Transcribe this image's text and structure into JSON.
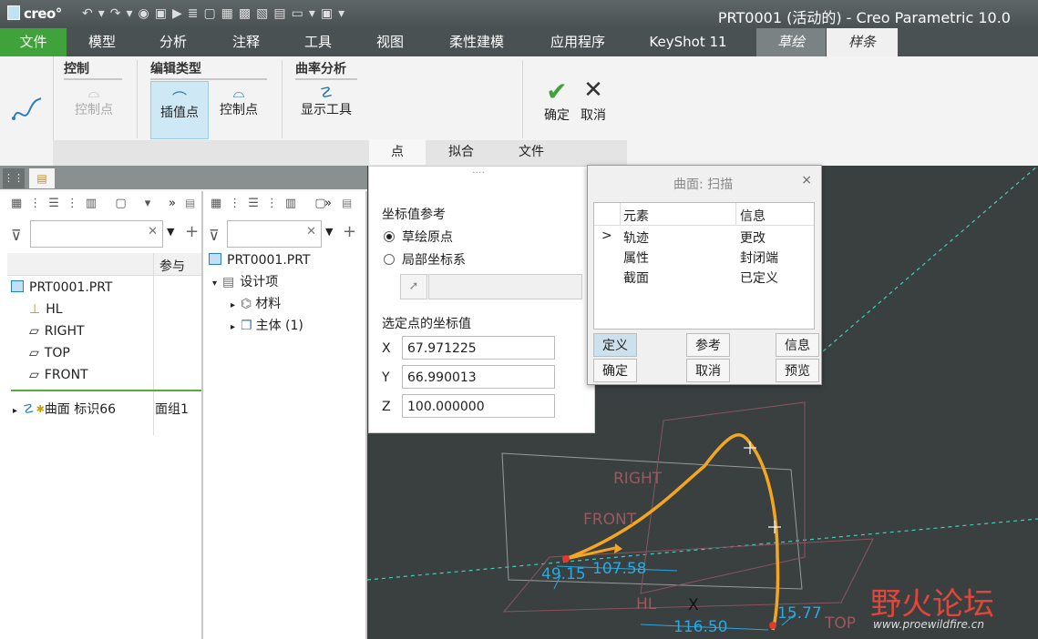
{
  "titlebar": {
    "logo": "creo",
    "window_title": "PRT0001 (活动的) - Creo Parametric 10.0"
  },
  "tabs": [
    {
      "label": "文件"
    },
    {
      "label": "模型"
    },
    {
      "label": "分析"
    },
    {
      "label": "注释"
    },
    {
      "label": "工具"
    },
    {
      "label": "视图"
    },
    {
      "label": "柔性建模"
    },
    {
      "label": "应用程序"
    },
    {
      "label": "KeyShot 11"
    },
    {
      "label": "草绘"
    },
    {
      "label": "样条"
    }
  ],
  "ribbon": {
    "control": {
      "title": "控制",
      "control_point": "控制点"
    },
    "edit_type": {
      "title": "编辑类型",
      "interp_point": "插值点",
      "control_point": "控制点"
    },
    "curvature": {
      "title": "曲率分析",
      "show_tool": "显示工具"
    },
    "ok": "确定",
    "cancel": "取消",
    "subtabs": [
      "点",
      "拟合",
      "文件"
    ]
  },
  "model_tree": {
    "col_ref": "参与",
    "root": "PRT0001.PRT",
    "items": [
      "HL",
      "RIGHT",
      "TOP",
      "FRONT"
    ],
    "feature": "曲面 标识66",
    "feature_ref": "面组1"
  },
  "design_tree": {
    "root": "PRT0001.PRT",
    "design_items": "设计项",
    "material": "材料",
    "body": "主体 (1)"
  },
  "points_panel": {
    "coord_ref_title": "坐标值参考",
    "opt_sketch_origin": "草绘原点",
    "opt_local_csys": "局部坐标系",
    "selected_title": "选定点的坐标值",
    "x_label": "X",
    "x": "67.971225",
    "y_label": "Y",
    "y": "66.990013",
    "z_label": "Z",
    "z": "100.000000"
  },
  "dialog": {
    "title": "曲面: 扫描",
    "col_element": "元素",
    "col_info": "信息",
    "rows": [
      {
        "marker": ">",
        "element": "轨迹",
        "info": "更改"
      },
      {
        "marker": "",
        "element": "属性",
        "info": "封闭端"
      },
      {
        "marker": "",
        "element": "截面",
        "info": "已定义"
      }
    ],
    "btn_define": "定义",
    "btn_ref": "参考",
    "btn_info": "信息",
    "btn_ok": "确定",
    "btn_cancel": "取消",
    "btn_preview": "预览"
  },
  "canvas": {
    "plane_right": "RIGHT",
    "plane_front": "FRONT",
    "plane_top": "TOP",
    "axis_hl": "HL",
    "axis_x": "X",
    "dim_1": "49.15",
    "dim_2": "107.58",
    "dim_3": "116.50",
    "dim_4": "15.77",
    "watermark": "野火论坛",
    "watermark_url": "www.proewildfire.cn"
  },
  "colors": {
    "accent_green": "#3fa23a",
    "spline": "#f4a623",
    "dim": "#2aa8e0"
  }
}
